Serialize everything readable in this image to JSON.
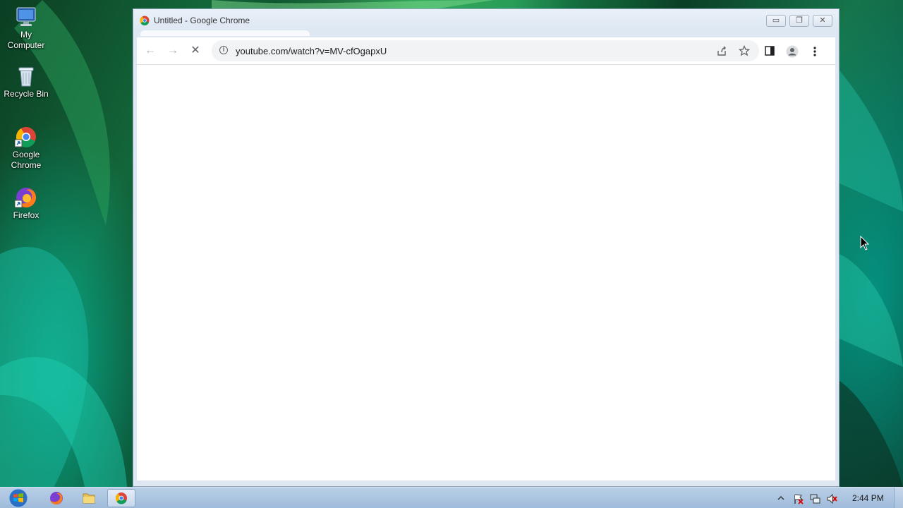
{
  "desktop": {
    "icons": [
      {
        "label": "My\nComputer",
        "icon": "computer-icon"
      },
      {
        "label": "Recycle Bin",
        "icon": "recycle-bin-icon"
      },
      {
        "label": "Google\nChrome",
        "icon": "chrome-icon"
      },
      {
        "label": "Firefox",
        "icon": "firefox-icon"
      }
    ]
  },
  "window": {
    "title": "Untitled - Google Chrome",
    "controls": {
      "minimize": "minimize-icon",
      "restore": "restore-icon",
      "close": "close-icon"
    }
  },
  "toolbar": {
    "url": "youtube.com/watch?v=MV-cfOgapxU",
    "back": "back-arrow-icon",
    "forward": "forward-arrow-icon",
    "stop": "stop-loading-icon",
    "info": "i",
    "share": "share-icon",
    "bookmark": "star-icon",
    "side_panel": "side-panel-icon",
    "profile": "profile-icon",
    "menu": "kebab-menu-icon"
  },
  "taskbar": {
    "apps": [
      "firefox-icon",
      "file-explorer-icon",
      "chrome-icon"
    ],
    "tray": [
      "show-hidden-icons-icon",
      "action-center-flag-icon",
      "network-icon",
      "volume-muted-icon"
    ],
    "clock": "2:44 PM"
  }
}
